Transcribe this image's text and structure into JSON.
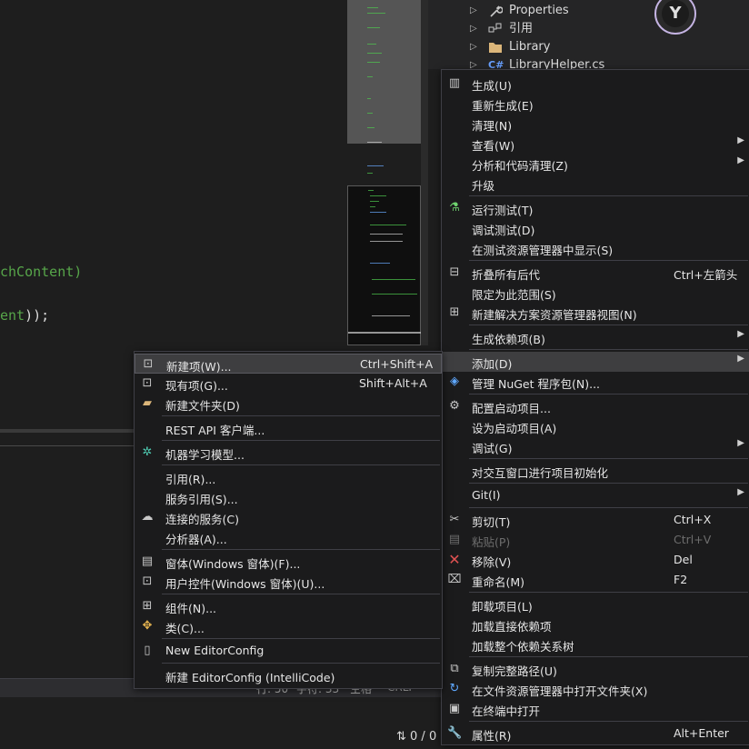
{
  "editor": {
    "code_line_1": "chContent)",
    "code_line_2": "ent",
    "code_line_2_tail": "));"
  },
  "status": {
    "line": "行: 50",
    "char": "字符: 33",
    "space": "空格",
    "crlf": "CRLF",
    "changes": "0 / 0"
  },
  "solution_explorer": {
    "items": [
      {
        "label": "Properties",
        "icon": "wrench-icon"
      },
      {
        "label": "引用",
        "icon": "references-icon"
      },
      {
        "label": "Library",
        "icon": "folder-icon"
      },
      {
        "label": "LibraryHelper.cs",
        "icon": "csharp-file-icon"
      }
    ]
  },
  "context_menu": {
    "items": [
      {
        "label": "生成(U)",
        "icon": "build-icon"
      },
      {
        "label": "重新生成(E)"
      },
      {
        "label": "清理(N)"
      },
      {
        "label": "查看(W)",
        "submenu": true
      },
      {
        "label": "分析和代码清理(Z)",
        "submenu": true
      },
      {
        "label": "升级"
      },
      {
        "label": "运行测试(T)",
        "icon": "run-tests-icon"
      },
      {
        "label": "调试测试(D)"
      },
      {
        "label": "在测试资源管理器中显示(S)"
      },
      {
        "label": "折叠所有后代",
        "shortcut": "Ctrl+左箭头",
        "icon": "collapse-icon"
      },
      {
        "label": "限定为此范围(S)"
      },
      {
        "label": "新建解决方案资源管理器视图(N)",
        "icon": "new-view-icon"
      },
      {
        "label": "生成依赖项(B)",
        "submenu": true
      },
      {
        "label": "添加(D)",
        "submenu": true
      },
      {
        "label": "管理 NuGet 程序包(N)...",
        "icon": "nuget-icon"
      },
      {
        "label": "配置启动项目...",
        "icon": "gear-icon"
      },
      {
        "label": "设为启动项目(A)"
      },
      {
        "label": "调试(G)",
        "submenu": true
      },
      {
        "label": "对交互窗口进行项目初始化"
      },
      {
        "label": "Git(I)",
        "submenu": true
      },
      {
        "label": "剪切(T)",
        "shortcut": "Ctrl+X",
        "icon": "scissors-icon"
      },
      {
        "label": "粘贴(P)",
        "shortcut": "Ctrl+V",
        "disabled": true,
        "icon": "paste-icon"
      },
      {
        "label": "移除(V)",
        "shortcut": "Del",
        "icon": "remove-x-icon"
      },
      {
        "label": "重命名(M)",
        "shortcut": "F2",
        "icon": "rename-icon"
      },
      {
        "label": "卸载项目(L)"
      },
      {
        "label": "加载直接依赖项"
      },
      {
        "label": "加载整个依赖关系树"
      },
      {
        "label": "复制完整路径(U)",
        "icon": "copy-icon"
      },
      {
        "label": "在文件资源管理器中打开文件夹(X)",
        "icon": "open-folder-icon"
      },
      {
        "label": "在终端中打开",
        "icon": "terminal-icon"
      },
      {
        "label": "属性(R)",
        "shortcut": "Alt+Enter",
        "icon": "wrench-icon"
      }
    ]
  },
  "add_submenu": {
    "items": [
      {
        "label": "新建项(W)...",
        "shortcut": "Ctrl+Shift+A",
        "icon": "new-item-icon"
      },
      {
        "label": "现有项(G)...",
        "shortcut": "Shift+Alt+A",
        "icon": "existing-item-icon"
      },
      {
        "label": "新建文件夹(D)",
        "icon": "new-folder-icon"
      },
      {
        "label": "REST API 客户端..."
      },
      {
        "label": "机器学习模型...",
        "icon": "ml-model-icon"
      },
      {
        "label": "引用(R)..."
      },
      {
        "label": "服务引用(S)..."
      },
      {
        "label": "连接的服务(C)",
        "icon": "connected-service-icon"
      },
      {
        "label": "分析器(A)..."
      },
      {
        "label": "窗体(Windows 窗体)(F)...",
        "icon": "form-icon"
      },
      {
        "label": "用户控件(Windows 窗体)(U)...",
        "icon": "user-control-icon"
      },
      {
        "label": "组件(N)...",
        "icon": "component-icon"
      },
      {
        "label": "类(C)...",
        "icon": "class-icon"
      },
      {
        "label": "New EditorConfig",
        "icon": "editorconfig-icon"
      },
      {
        "label": "新建 EditorConfig (IntelliCode)"
      }
    ]
  }
}
